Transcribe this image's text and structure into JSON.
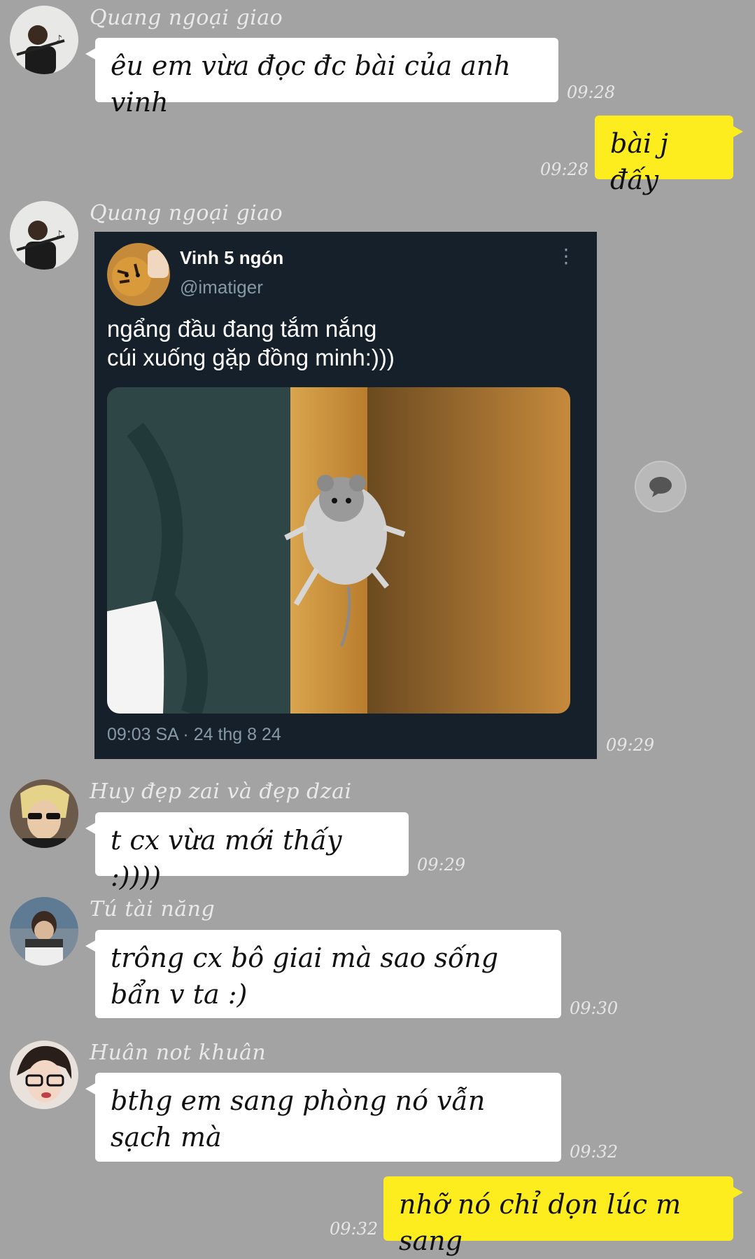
{
  "messages": [
    {
      "sender": "Quang ngoại giao",
      "text": "êu em vừa đọc đc bài của anh vinh",
      "time": "09:28"
    },
    {
      "text": "bài j đấy",
      "time": "09:28"
    },
    {
      "sender": "Quang ngoại giao",
      "time": "09:29"
    },
    {
      "sender": "Huy đẹp zai và đẹp dzai",
      "text": "t cx vừa mới thấy :))))",
      "time": "09:29"
    },
    {
      "sender": "Tú tài năng",
      "text": "trông cx bô giai mà sao sống bẩn v ta :)",
      "time": "09:30"
    },
    {
      "sender": "Huân not khuân",
      "text": "bthg em sang phòng nó vẫn sạch mà",
      "time": "09:32"
    },
    {
      "text": "nhỡ nó chỉ dọn lúc m sang",
      "time": "09:32"
    }
  ],
  "tweet": {
    "name": "Vinh 5 ngón",
    "handle": "@imatiger",
    "text": "ngẩng đầu đang tắm nắng\ncúi xuống gặp đồng minh:)))",
    "meta": "09:03 SA · 24 thg 8 24",
    "menu_icon": "more-vertical-icon"
  },
  "colors": {
    "background": "#a3a3a3",
    "incoming_bubble": "#ffffff",
    "outgoing_bubble": "#fdec1e",
    "tweet_background": "#15202b"
  }
}
